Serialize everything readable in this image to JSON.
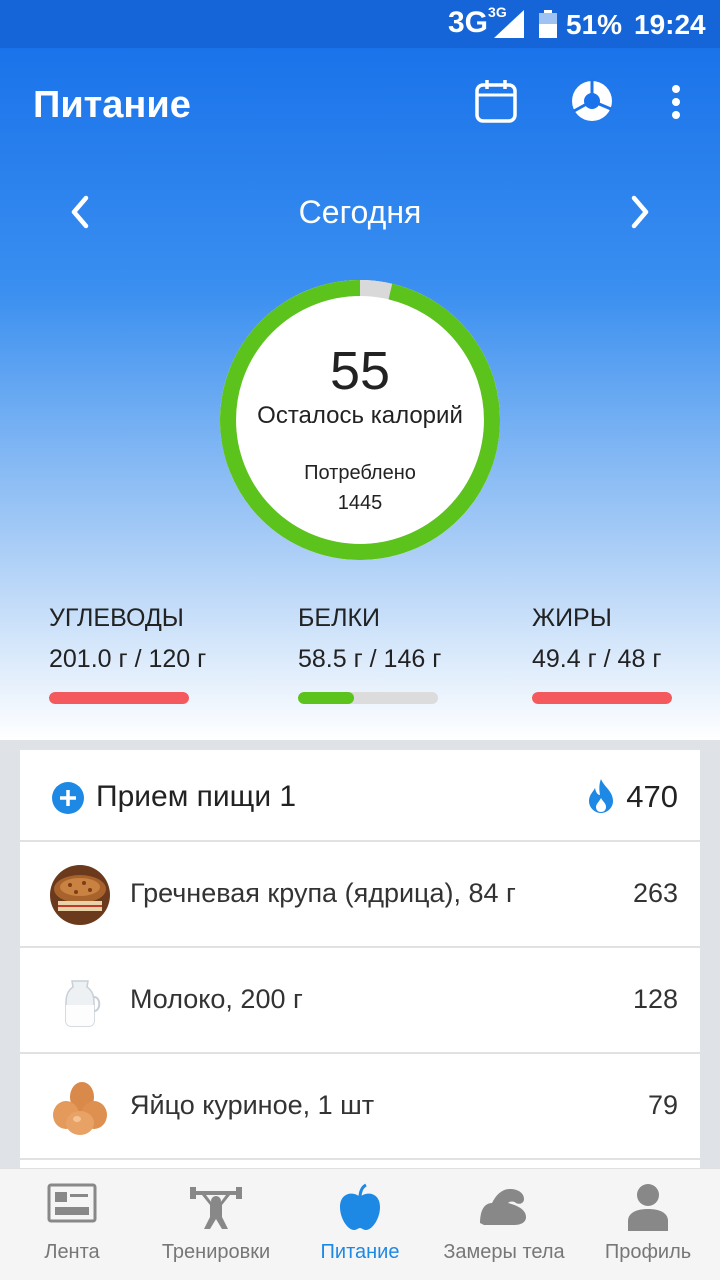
{
  "status_bar": {
    "network": "3G",
    "network_sup": "3G",
    "battery": "51%",
    "time": "19:24"
  },
  "appbar": {
    "title": "Питание",
    "icons": [
      "calendar-icon",
      "pie-chart-icon",
      "more-vert-icon"
    ]
  },
  "day_nav": {
    "label": "Сегодня"
  },
  "calories": {
    "remaining": "55",
    "remaining_label": "Осталось калорий",
    "consumed_label": "Потреблено",
    "consumed": "1445",
    "progress_fraction": 0.963
  },
  "macros": [
    {
      "name": "УГЛЕВОДЫ",
      "amount": "201.0 г / 120 г",
      "fraction": 1.0,
      "color": "#f4595d"
    },
    {
      "name": "БЕЛКИ",
      "amount": "58.5 г / 146 г",
      "fraction": 0.4,
      "color": "#5cc21c"
    },
    {
      "name": "ЖИРЫ",
      "amount": "49.4 г / 48 г",
      "fraction": 1.0,
      "color": "#f4595d"
    }
  ],
  "meal": {
    "title": "Прием пищи 1",
    "kcal": "470",
    "items": [
      {
        "name": "Гречневая крупа (ядрица), 84 г",
        "kcal": "263",
        "icon": "buckwheat-image"
      },
      {
        "name": "Молоко, 200 г",
        "kcal": "128",
        "icon": "milk-image"
      },
      {
        "name": "Яйцо куриное, 1 шт",
        "kcal": "79",
        "icon": "eggs-image"
      }
    ]
  },
  "bottom_nav": [
    {
      "label": "Лента",
      "icon": "feed-icon",
      "active": false
    },
    {
      "label": "Тренировки",
      "icon": "workout-icon",
      "active": false
    },
    {
      "label": "Питание",
      "icon": "apple-icon",
      "active": true
    },
    {
      "label": "Замеры тела",
      "icon": "muscle-icon",
      "active": false
    },
    {
      "label": "Профиль",
      "icon": "profile-icon",
      "active": false
    }
  ],
  "colors": {
    "primary": "#1a73ea",
    "accent": "#1e88e5",
    "ring": "#5cc21c",
    "over": "#f4595d"
  }
}
